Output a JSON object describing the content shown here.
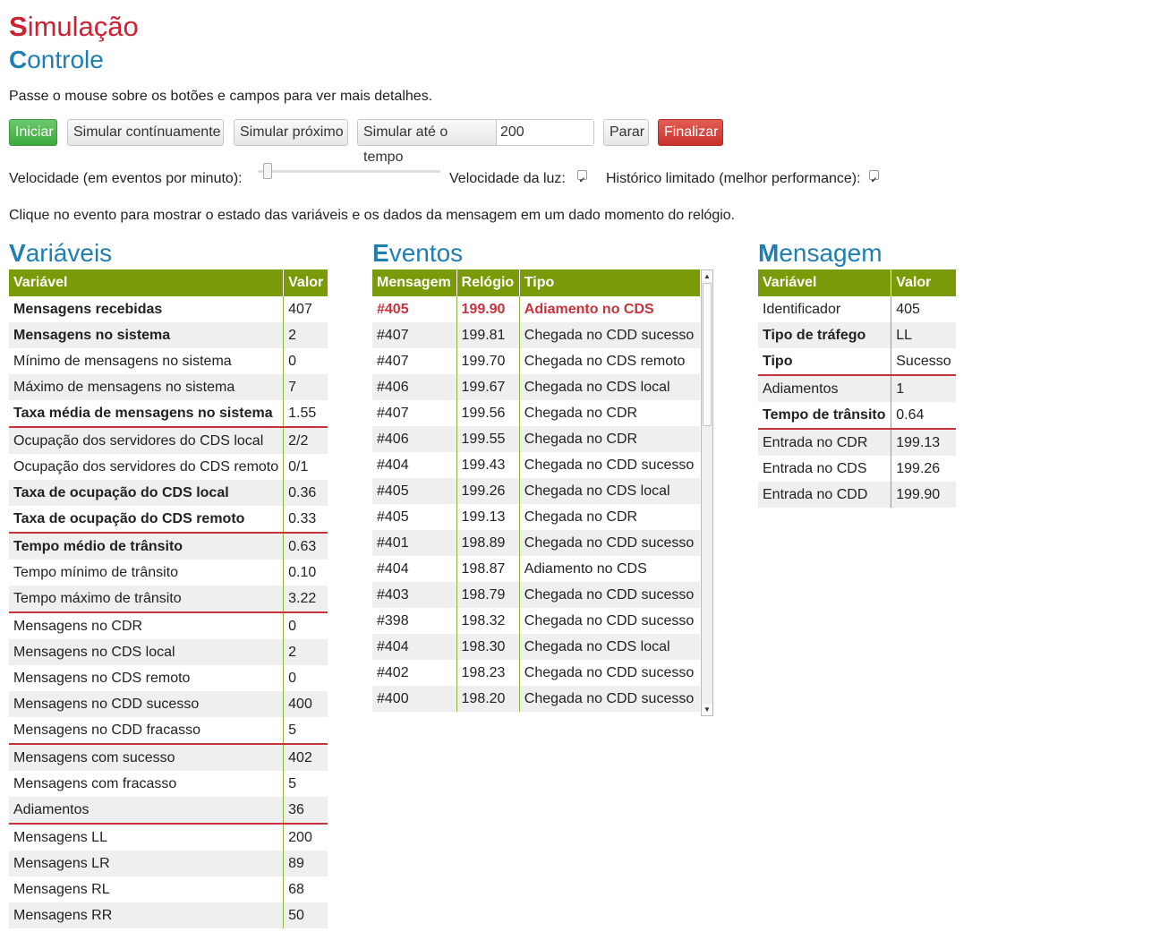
{
  "header": {
    "title_first": "S",
    "title_rest": "imulação",
    "subtitle_first": "C",
    "subtitle_rest": "ontrole"
  },
  "hint_top": "Passe o mouse sobre os botões e campos para ver mais detalhes.",
  "toolbar": {
    "iniciar": "Iniciar",
    "continuo": "Simular contínuamente",
    "proximo": "Simular próximo",
    "ate_label": "Simular até o tempo",
    "ate_value": "200",
    "parar": "Parar",
    "finalizar": "Finalizar"
  },
  "options": {
    "speed_label": "Velocidade (em eventos por minuto):",
    "speed_level": 0.03,
    "light_label": "Velocidade da luz:",
    "light_checked": true,
    "history_label": "Histórico limitado (melhor performance):",
    "history_checked": true
  },
  "hint_events": "Clique no evento para mostrar o estado das variáveis e os dados da mensagem em um dado momento do relógio.",
  "colors": {
    "green_header": "#7a9a07",
    "separator": "#c8323a",
    "title_red": "#cc2233",
    "title_blue": "#1f7fb3"
  },
  "variables": {
    "title_first": "V",
    "title_rest": "ariáveis",
    "headers": [
      "Variável",
      "Valor"
    ],
    "rows": [
      {
        "name": "Mensagens recebidas",
        "value": "407",
        "bold": true,
        "sep": false
      },
      {
        "name": "Mensagens no sistema",
        "value": "2",
        "bold": true,
        "sep": false
      },
      {
        "name": "Mínimo de mensagens no sistema",
        "value": "0",
        "bold": false,
        "sep": false
      },
      {
        "name": "Máximo de mensagens no sistema",
        "value": "7",
        "bold": false,
        "sep": false
      },
      {
        "name": "Taxa média de mensagens no sistema",
        "value": "1.55",
        "bold": true,
        "sep": false
      },
      {
        "name": "Ocupação dos servidores do CDS local",
        "value": "2/2",
        "bold": false,
        "sep": true
      },
      {
        "name": "Ocupação dos servidores do CDS remoto",
        "value": "0/1",
        "bold": false,
        "sep": false
      },
      {
        "name": "Taxa de ocupação do CDS local",
        "value": "0.36",
        "bold": true,
        "sep": false
      },
      {
        "name": "Taxa de ocupação do CDS remoto",
        "value": "0.33",
        "bold": true,
        "sep": false
      },
      {
        "name": "Tempo médio de trânsito",
        "value": "0.63",
        "bold": true,
        "sep": true
      },
      {
        "name": "Tempo mínimo de trânsito",
        "value": "0.10",
        "bold": false,
        "sep": false
      },
      {
        "name": "Tempo máximo de trânsito",
        "value": "3.22",
        "bold": false,
        "sep": false
      },
      {
        "name": "Mensagens no CDR",
        "value": "0",
        "bold": false,
        "sep": true
      },
      {
        "name": "Mensagens no CDS local",
        "value": "2",
        "bold": false,
        "sep": false
      },
      {
        "name": "Mensagens no CDS remoto",
        "value": "0",
        "bold": false,
        "sep": false
      },
      {
        "name": "Mensagens no CDD sucesso",
        "value": "400",
        "bold": false,
        "sep": false
      },
      {
        "name": "Mensagens no CDD fracasso",
        "value": "5",
        "bold": false,
        "sep": false
      },
      {
        "name": "Mensagens com sucesso",
        "value": "402",
        "bold": false,
        "sep": true
      },
      {
        "name": "Mensagens com fracasso",
        "value": "5",
        "bold": false,
        "sep": false
      },
      {
        "name": "Adiamentos",
        "value": "36",
        "bold": false,
        "sep": false
      },
      {
        "name": "Mensagens LL",
        "value": "200",
        "bold": false,
        "sep": true
      },
      {
        "name": "Mensagens LR",
        "value": "89",
        "bold": false,
        "sep": false
      },
      {
        "name": "Mensagens RL",
        "value": "68",
        "bold": false,
        "sep": false
      },
      {
        "name": "Mensagens RR",
        "value": "50",
        "bold": false,
        "sep": false
      }
    ]
  },
  "events": {
    "title_first": "E",
    "title_rest": "ventos",
    "headers": [
      "Mensagem",
      "Relógio",
      "Tipo"
    ],
    "rows": [
      {
        "msg": "#405",
        "clock": "199.90",
        "type": "Adiamento no CDS",
        "highlight": true
      },
      {
        "msg": "#407",
        "clock": "199.81",
        "type": "Chegada no CDD sucesso",
        "highlight": false
      },
      {
        "msg": "#407",
        "clock": "199.70",
        "type": "Chegada no CDS remoto",
        "highlight": false
      },
      {
        "msg": "#406",
        "clock": "199.67",
        "type": "Chegada no CDS local",
        "highlight": false
      },
      {
        "msg": "#407",
        "clock": "199.56",
        "type": "Chegada no CDR",
        "highlight": false
      },
      {
        "msg": "#406",
        "clock": "199.55",
        "type": "Chegada no CDR",
        "highlight": false
      },
      {
        "msg": "#404",
        "clock": "199.43",
        "type": "Chegada no CDD sucesso",
        "highlight": false
      },
      {
        "msg": "#405",
        "clock": "199.26",
        "type": "Chegada no CDS local",
        "highlight": false
      },
      {
        "msg": "#405",
        "clock": "199.13",
        "type": "Chegada no CDR",
        "highlight": false
      },
      {
        "msg": "#401",
        "clock": "198.89",
        "type": "Chegada no CDD sucesso",
        "highlight": false
      },
      {
        "msg": "#404",
        "clock": "198.87",
        "type": "Adiamento no CDS",
        "highlight": false
      },
      {
        "msg": "#403",
        "clock": "198.79",
        "type": "Chegada no CDD sucesso",
        "highlight": false
      },
      {
        "msg": "#398",
        "clock": "198.32",
        "type": "Chegada no CDD sucesso",
        "highlight": false
      },
      {
        "msg": "#404",
        "clock": "198.30",
        "type": "Chegada no CDS local",
        "highlight": false
      },
      {
        "msg": "#402",
        "clock": "198.23",
        "type": "Chegada no CDD sucesso",
        "highlight": false
      },
      {
        "msg": "#400",
        "clock": "198.20",
        "type": "Chegada no CDD sucesso",
        "highlight": false
      }
    ]
  },
  "message": {
    "title_first": "M",
    "title_rest": "ensagem",
    "headers": [
      "Variável",
      "Valor"
    ],
    "rows": [
      {
        "name": "Identificador",
        "value": "405",
        "bold": false,
        "sep": false
      },
      {
        "name": "Tipo de tráfego",
        "value": "LL",
        "bold": true,
        "sep": false
      },
      {
        "name": "Tipo",
        "value": "Sucesso",
        "bold": true,
        "sep": false
      },
      {
        "name": "Adiamentos",
        "value": "1",
        "bold": false,
        "sep": true
      },
      {
        "name": "Tempo de trânsito",
        "value": "0.64",
        "bold": true,
        "sep": false
      },
      {
        "name": "Entrada no CDR",
        "value": "199.13",
        "bold": false,
        "sep": true
      },
      {
        "name": "Entrada no CDS",
        "value": "199.26",
        "bold": false,
        "sep": false
      },
      {
        "name": "Entrada no CDD",
        "value": "199.90",
        "bold": false,
        "sep": false
      }
    ]
  }
}
